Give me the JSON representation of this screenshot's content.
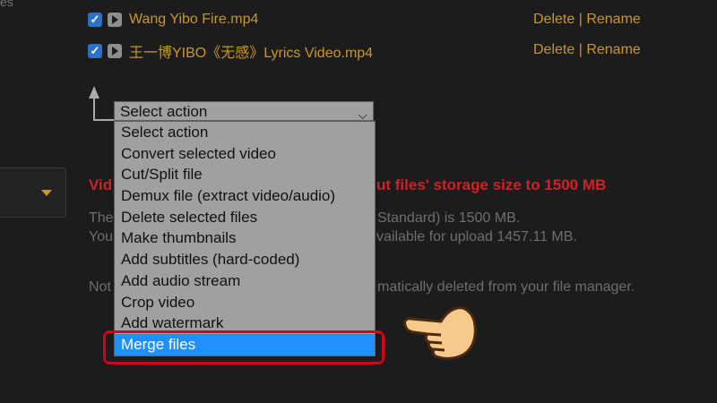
{
  "left_fragment": "es",
  "files": [
    {
      "name": "Wang Yibo Fire.mp4",
      "delete": "Delete",
      "sep": "|",
      "rename": "Rename"
    },
    {
      "name": "王一博YIBO《无感》Lyrics Video.mp4",
      "delete": "Delete",
      "sep": "|",
      "rename": "Rename"
    }
  ],
  "action_select": {
    "value": "Select action",
    "options": [
      "Select action",
      "Convert selected video",
      "Cut/Split file",
      "Demux file (extract video/audio)",
      "Delete selected files",
      "Make thumbnails",
      "Add subtitles (hard-coded)",
      "Add audio stream",
      "Crop video",
      "Add watermark",
      "Merge files"
    ],
    "highlighted": "Merge files"
  },
  "notice": {
    "red_left": "Vid",
    "red_right": "ut files' storage size to 1500 MB",
    "line1_left": "The",
    "line1_right": "Standard) is 1500 MB.",
    "line2_left": "You",
    "line2_right": "vailable for upload 1457.11 MB.",
    "line3_left": "Not",
    "line3_right": "matically deleted from your file manager."
  },
  "colors": {
    "accent": "#c9962a",
    "warning": "#d12027",
    "selected": "#1e90ff",
    "highlight_box": "#d0021b"
  }
}
